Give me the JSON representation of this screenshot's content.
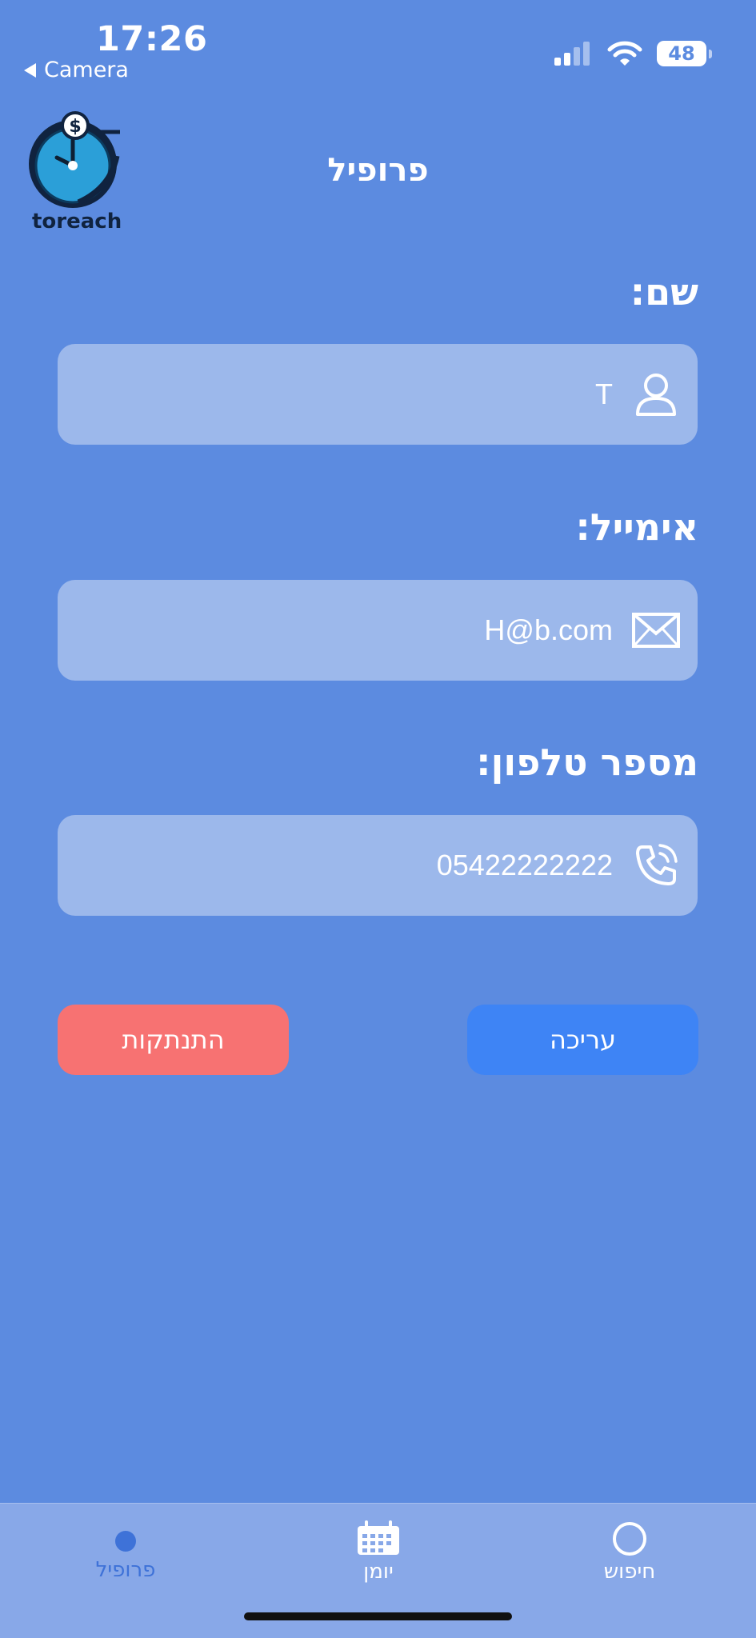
{
  "status_bar": {
    "time": "17:26",
    "back_label": "Camera",
    "battery": "48"
  },
  "header": {
    "logo_text": "toreach",
    "title": "פרופיל"
  },
  "profile": {
    "name_label": "שם:",
    "name_value": "T",
    "email_label": "אימייל:",
    "email_value": "H@b.com",
    "phone_label": "מספר טלפון:",
    "phone_value": "05422222222"
  },
  "actions": {
    "edit_label": "עריכה",
    "logout_label": "התנתקות"
  },
  "nav": {
    "tabs": [
      {
        "label": "פרופיל",
        "icon": "profile-dot-icon",
        "active": true
      },
      {
        "label": "יומן",
        "icon": "calendar-icon",
        "active": false
      },
      {
        "label": "חיפוש",
        "icon": "search-icon",
        "active": false
      }
    ]
  },
  "colors": {
    "background": "#5C8BE0",
    "field": "#9CB8EB",
    "edit_button": "#3E84F5",
    "logout_button": "#F77272",
    "active_tab": "#3E72D8"
  }
}
